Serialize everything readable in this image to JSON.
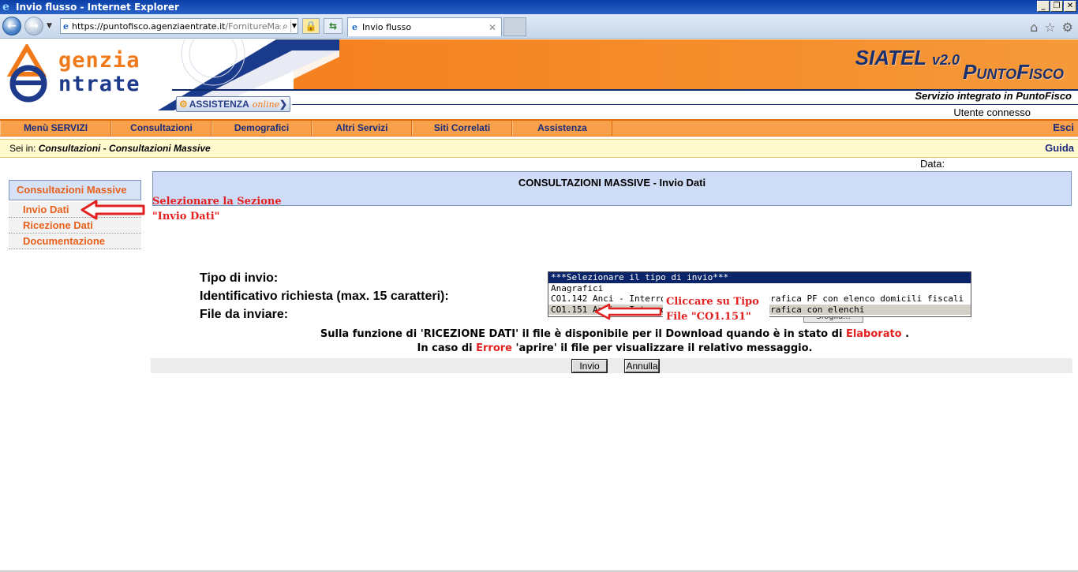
{
  "browser": {
    "title": "Invio flusso - Internet Explorer",
    "url_scheme": "https://",
    "url_host": "puntofisco.agenziaentrate.it",
    "url_rest": "/FornitureMass",
    "tab_title": "Invio flusso"
  },
  "header": {
    "logo_line1": "genzia",
    "logo_line2": "ntrate",
    "product": "SIATEL",
    "version": "v2.0",
    "product2": "PuntoFisco",
    "assistenza_label": "ASSISTENZA",
    "assistenza_online": "online",
    "servizio": "Servizio integrato in PuntoFisco",
    "utente": "Utente connesso"
  },
  "menu": {
    "items": [
      "Menù SERVIZI",
      "Consultazioni",
      "Demografici",
      "Altri Servizi",
      "Siti Correlati",
      "Assistenza"
    ],
    "esci": "Esci"
  },
  "breadcrumb": {
    "prefix": "Sei in:",
    "path": "Consultazioni - Consultazioni Massive",
    "guida": "Guida"
  },
  "data_label": "Data:",
  "sidebar": {
    "title": "Consultazioni Massive",
    "items": [
      "Invio Dati",
      "Ricezione Dati",
      "Documentazione"
    ]
  },
  "panel": {
    "title": "CONSULTAZIONI MASSIVE - Invio Dati"
  },
  "annotations": {
    "section_l1": "Selezionare la Sezione",
    "section_l2": "\"Invio Dati\"",
    "tipo_l1": "Cliccare su Tipo",
    "tipo_l2": "File \"CO1.151\""
  },
  "form": {
    "tipo_label": "Tipo di invio:",
    "id_label": "Identificativo richiesta (max. 15 caratteri):",
    "file_label": "File da inviare:",
    "options": [
      "***Selezionare il tipo di invio***",
      "Anagrafici",
      "CO1.142 Anci - Interrogazione massiva anagrafica PF con elenco domicili fiscali",
      "CO1.151 Anci - Interrogazione massiva anagrafica con elenchi"
    ],
    "sfoglia": "Sfoglia..."
  },
  "notes": {
    "n1_a": "Sulla funzione di 'RICEZIONE DATI' il file è disponibile per il Download quando è in stato di",
    "n1_b": "Elaborato",
    "n1_c": ".",
    "n2_a": "In caso di",
    "n2_b": "Errore",
    "n2_c": "'aprire' il file per visualizzare il relativo messaggio."
  },
  "buttons": {
    "invio": "Invio",
    "annulla": "Annulla"
  },
  "colors": {
    "orange": "#f58120",
    "navy": "#1b2a7a",
    "annotation_red": "#e32020",
    "sidebar_orange": "#e8601c"
  }
}
